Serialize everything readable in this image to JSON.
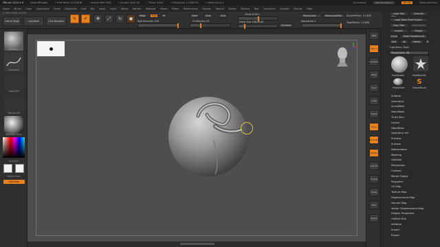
{
  "titlebar": {
    "app": "ZBrush 2022.0.6",
    "project": "DefaultProject",
    "free_mem": "• Free Mem 22.038GB",
    "active_mem": "• Active Mem 846",
    "scratch": "• Scratch Disk 49",
    "timer": "• Timer 0.001",
    "polycount": "• PolyCount 11.880 KP",
    "meshcount": "• MeshCount 1",
    "quicksave": "QuickSave",
    "seethrough": "See-through 0",
    "menus": "Menus",
    "defaultscript": "DefaultZScript"
  },
  "menubar": [
    "Alpha",
    "Brush",
    "Color",
    "Document",
    "Draw",
    "Dynamics",
    "Edit",
    "File",
    "Layer",
    "Light",
    "Macro",
    "Marker",
    "Material",
    "Movie",
    "Picker",
    "Preferences",
    "Render",
    "Stencil",
    "Stroke",
    "Texture",
    "Tool",
    "Transform",
    "Zplugin",
    "Zscript",
    "Help"
  ],
  "coords": "-0.283,0.993,-0.078",
  "topshelf": {
    "home_page": "Home Page",
    "lightbox": "LightBox",
    "live_boolean": "Live Boolean",
    "edit": "Edit",
    "draw": "Draw",
    "move": "Move",
    "scale": "Scale",
    "rotate": "Rotate",
    "mrgb": "Mrgb",
    "rgb": "Rgb",
    "m": "M",
    "zadd": "Zadd",
    "zsub": "Zsub",
    "zcut": "Zcut",
    "rgb_intensity": "Rgb Intensity 100",
    "z_intensity": "Z Intensity 25",
    "focal_shift": "Focal Shift 0",
    "draw_size": "Draw Size 158.8142",
    "dynamic": "Dynamic",
    "replay_last": "ReplayLast",
    "replay_last_rel": "ReplayLastRel",
    "adjust_last": "AdjustLast 1",
    "active_points": "ActivePoints: 11,858",
    "total_points": "TotalPoints: 11,858"
  },
  "leftshelf": {
    "brush": "Standard",
    "stroke": "FreeHand",
    "alpha": "Alpha Off",
    "texture": "Texture Off",
    "material": "BasicMat Silver",
    "gradient": "Gradient",
    "switchcolor": "SwitchColor",
    "alternate": "Alternate"
  },
  "rightshelf": [
    "BPR",
    "SPix 3",
    "Dynamic",
    "Persp",
    "Floor",
    "Local",
    "Frame",
    "Move",
    "Zoom3D",
    "Rotate",
    "Line Fill",
    "Transp",
    "Ghost",
    "Solo",
    "Xpose"
  ],
  "palette": {
    "title": "Tool",
    "load_tool": "Load Tool",
    "save_as": "Save As",
    "load_from_project": "Load Tools From Project",
    "copy_tool": "Copy Tool",
    "paste_tool": "Paste Tool",
    "import": "Import",
    "export": "Export",
    "clone": "Clone",
    "make_polymesh": "Make PolyMesh3D",
    "goz": "GoZ",
    "all": "All",
    "visible": "Visible",
    "r": "R",
    "lightbox_tools": "Lightbox ▸ Tools",
    "polysphere_slider": "PolySphere. 48",
    "tools": [
      "PolySphere",
      "PolyMesh3D",
      "SimpleBrush"
    ],
    "tool_caption": "PolySphere",
    "items": [
      "Subtool",
      "Geometry",
      "ArrayMesh",
      "NanoMesh",
      "Thick Skin",
      "Layers",
      "FiberMesh",
      "Geometry HD",
      "Preview",
      "Surface",
      "Deformation",
      "Masking",
      "Visibility",
      "Polygroups",
      "Contact",
      "Morph Target",
      "Polypaint",
      "UV Map",
      "Texture Map",
      "Displacement Map",
      "Normal Map",
      "Vector Displacement Map",
      "Display Properties",
      "Unified Skin",
      "Initialize",
      "Import",
      "Export"
    ]
  },
  "colors": {
    "accent": "#e8821e",
    "canvas": "#4c4c4c",
    "panel": "#2f2f2f"
  }
}
